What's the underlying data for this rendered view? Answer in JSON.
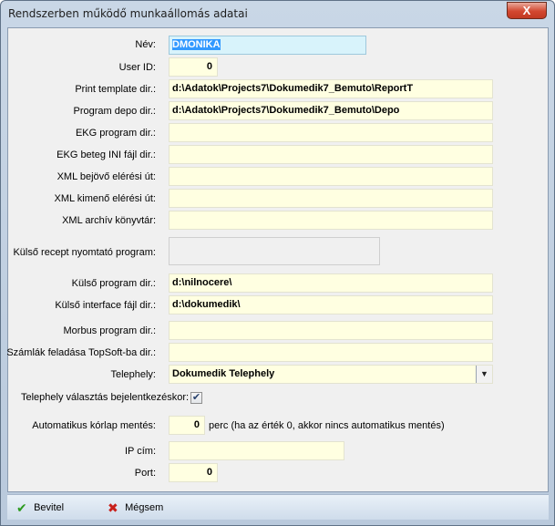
{
  "window": {
    "title": "Rendszerben működő munkaállomás adatai",
    "close_glyph": "X"
  },
  "fields": {
    "nev": {
      "label": "Név:",
      "value": "DMONIKA"
    },
    "user_id": {
      "label": "User ID:",
      "value": "0"
    },
    "print_template": {
      "label": "Print template dir.:",
      "value": "d:\\Adatok\\Projects7\\Dokumedik7_Bemuto\\ReportT"
    },
    "program_depo": {
      "label": "Program depo dir.:",
      "value": "d:\\Adatok\\Projects7\\Dokumedik7_Bemuto\\Depo"
    },
    "ekg_program": {
      "label": "EKG program dir.:",
      "value": ""
    },
    "ekg_beteg_ini": {
      "label": "EKG beteg INI fájl dir.:",
      "value": ""
    },
    "xml_bejovo": {
      "label": "XML bejövő elérési út:",
      "value": ""
    },
    "xml_kimeno": {
      "label": "XML kimenő elérési út:",
      "value": ""
    },
    "xml_archiv": {
      "label": "XML archív könyvtár:",
      "value": ""
    },
    "kulso_recept": {
      "label": "Külső recept nyomtató program:",
      "value": ""
    },
    "kulso_program": {
      "label": "Külső program dir.:",
      "value": "d:\\nilnocere\\"
    },
    "kulso_interface": {
      "label": "Külső interface fájl dir.:",
      "value": "d:\\dokumedik\\"
    },
    "morbus": {
      "label": "Morbus program dir.:",
      "value": ""
    },
    "szamlak": {
      "label": "Számlák feladása TopSoft-ba dir.:",
      "value": ""
    },
    "telephely": {
      "label": "Telephely:",
      "value": "Dokumedik Telephely"
    },
    "telephely_valasztas": {
      "label": "Telephely választás bejelentkezéskor:",
      "checked": true
    },
    "korlap": {
      "label": "Automatikus kórlap mentés:",
      "value": "0",
      "suffix": "perc (ha az érték 0, akkor nincs automatikus mentés)"
    },
    "ip": {
      "label": "IP cím:",
      "value": ""
    },
    "port": {
      "label": "Port:",
      "value": "0"
    }
  },
  "buttons": {
    "ok": "Bevitel",
    "cancel": "Mégsem"
  },
  "icons": {
    "checkmark": "✔",
    "cross": "✖",
    "dropdown": "▼"
  }
}
